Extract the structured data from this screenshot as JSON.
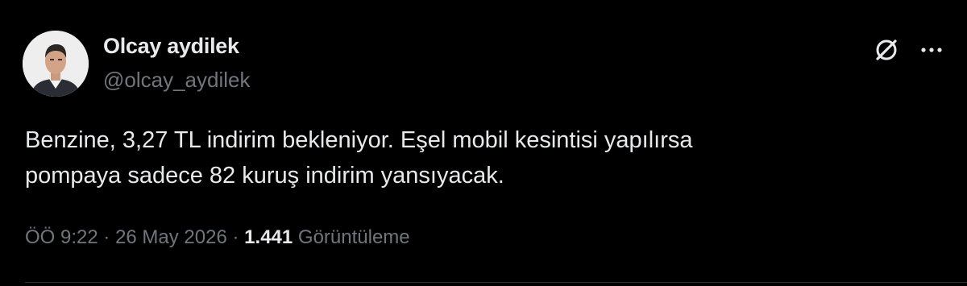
{
  "author": {
    "display_name": "Olcay aydilek",
    "handle": "@olcay_aydilek",
    "avatar_icon": "person-photo"
  },
  "header_actions": {
    "grok_icon": "grok-icon",
    "more_icon": "more-dots-icon"
  },
  "tweet": {
    "lines": [
      "Benzine, 3,27 TL indirim bekleniyor. Eşel mobil kesintisi yapılırsa",
      "pompaya sadece 82 kuruş indirim yansıyacak."
    ]
  },
  "meta": {
    "time": "ÖÖ 9:22",
    "separator": "·",
    "date": "26 May 2026",
    "views_count": "1.441",
    "views_label": "Görüntüleme"
  },
  "colors": {
    "background": "#000000",
    "primary_text": "#e7e9ea",
    "secondary_text": "#71767b",
    "border": "#2f3336"
  }
}
